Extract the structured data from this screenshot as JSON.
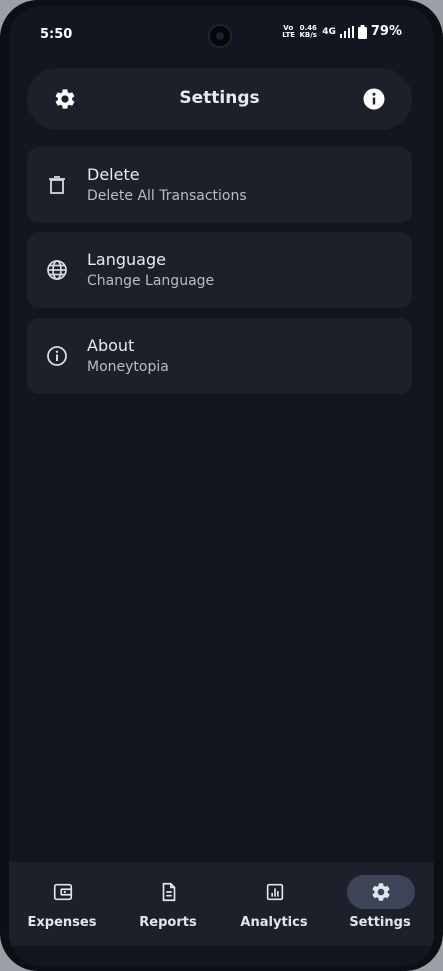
{
  "status": {
    "time": "5:50",
    "volte": "Vo LTE",
    "speed": "0.46 KB/s",
    "network": "4G",
    "battery": "79%"
  },
  "topbar": {
    "title": "Settings",
    "left_icon": "gear-icon",
    "right_icon": "info-icon"
  },
  "settings_items": [
    {
      "label": "Delete",
      "sub": "Delete All Transactions",
      "icon": "trash-icon"
    },
    {
      "label": "Language",
      "sub": "Change Language",
      "icon": "globe-icon"
    },
    {
      "label": "About",
      "sub": "Moneytopia",
      "icon": "info-outline-icon"
    }
  ],
  "nav": [
    {
      "label": "Expenses",
      "icon": "wallet-icon",
      "active": false
    },
    {
      "label": "Reports",
      "icon": "document-icon",
      "active": false
    },
    {
      "label": "Analytics",
      "icon": "analytics-icon",
      "active": false
    },
    {
      "label": "Settings",
      "icon": "gear-icon",
      "active": true
    }
  ],
  "colors": {
    "background": "#111620",
    "surface": "#1b202b",
    "active_pill": "#3d4457",
    "text": "#e8eaef"
  }
}
